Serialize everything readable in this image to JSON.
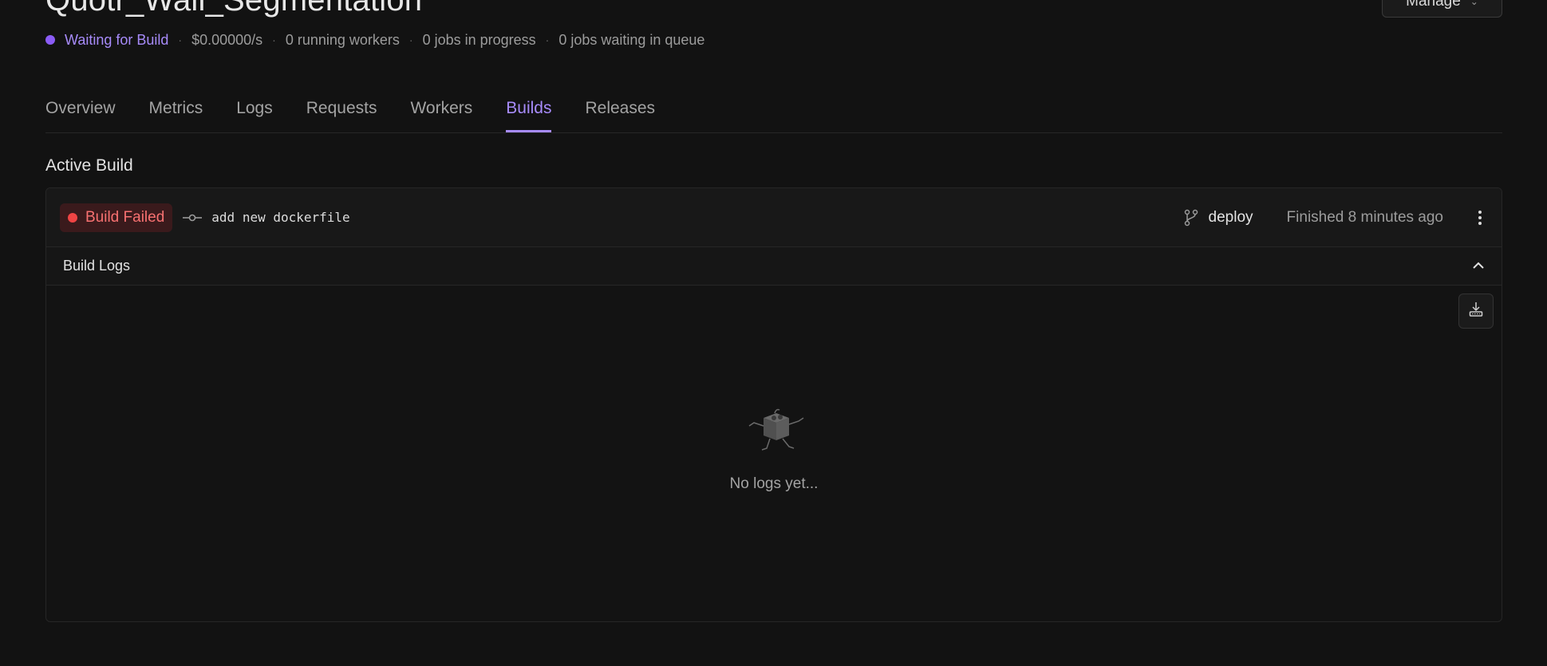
{
  "header": {
    "title": "Quotr_Wall_Segmentation",
    "manage_label": "Manage",
    "status": {
      "state": "Waiting for Build",
      "state_color": "#a78bfa",
      "cost": "$0.00000/s",
      "running_workers": "0 running workers",
      "jobs_in_progress": "0 jobs in progress",
      "jobs_waiting": "0 jobs waiting in queue"
    }
  },
  "tabs": [
    {
      "label": "Overview",
      "active": false
    },
    {
      "label": "Metrics",
      "active": false
    },
    {
      "label": "Logs",
      "active": false
    },
    {
      "label": "Requests",
      "active": false
    },
    {
      "label": "Workers",
      "active": false
    },
    {
      "label": "Builds",
      "active": true
    },
    {
      "label": "Releases",
      "active": false
    }
  ],
  "active_build": {
    "section_title": "Active Build",
    "status_label": "Build Failed",
    "status_color": "#ef4444",
    "commit_icon": "git-commit-icon",
    "commit_message": "add new dockerfile",
    "branch_icon": "git-branch-icon",
    "branch": "deploy",
    "finished": "Finished 8 minutes ago",
    "more_icon": "vertical-ellipsis-icon"
  },
  "build_logs": {
    "title": "Build Logs",
    "collapse_icon": "chevron-up-icon",
    "download_icon": "download-icon",
    "empty_icon": "running-box-mascot-icon",
    "empty_text": "No logs yet..."
  },
  "colors": {
    "background": "#121212",
    "accent": "#a78bfa",
    "danger": "#ef4444"
  }
}
